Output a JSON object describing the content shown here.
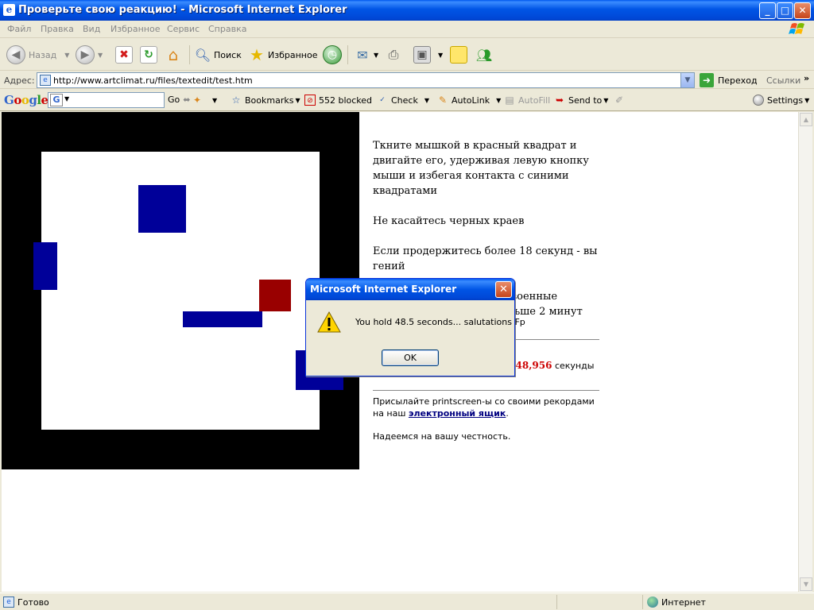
{
  "window": {
    "title": "Проверьте свою реакцию! - Microsoft Internet Explorer",
    "min_label": "_",
    "max_label": "□",
    "close_label": "✕"
  },
  "menu": [
    "Файл",
    "Правка",
    "Вид",
    "Избранное",
    "Сервис",
    "Справка"
  ],
  "toolbar": {
    "back": "Назад",
    "search": "Поиск",
    "favorites": "Избранное"
  },
  "address": {
    "label": "Адрес:",
    "url": "http://www.artclimat.ru/files/textedit/test.htm",
    "go": "Переход",
    "links": "Ссылки",
    "more": "»"
  },
  "googlebar": {
    "logo": "Google",
    "go": "Go",
    "bookmarks": "Bookmarks",
    "blocked": "552 blocked",
    "check": "Check",
    "autolink": "AutoLink",
    "autofill": "AutoFill",
    "sendto": "Send to",
    "settings": "Settings"
  },
  "page": {
    "instruction": "Ткните мышкой в красный квадрат и двигайте его, удерживая левую кнопку мыши и избегая контакта с синими квадратами",
    "rule": "Не касайтесь черных краев",
    "genius": "Если продержитесь более 18 секунд - вы гений",
    "military": "е военные",
    "military_time": "ольше 2 минут",
    "result_value": "48,956",
    "result_unit": "секунды",
    "send_text": "Присылайте printscreen-ы со своими рекордами на наш ",
    "send_link": "электронный ящик",
    "send_end": ".",
    "honest": "Надеемся на вашу честность."
  },
  "dialog": {
    "title": "Microsoft Internet Explorer",
    "message": "You hold 48.5 seconds... salutations Fp",
    "ok": "OK"
  },
  "status": {
    "left": "Готово",
    "zone": "Интернет"
  },
  "colors": {
    "game_border": "#000000",
    "blue_block": "#000099",
    "red_square": "#990000",
    "result_red": "#cc0000"
  }
}
